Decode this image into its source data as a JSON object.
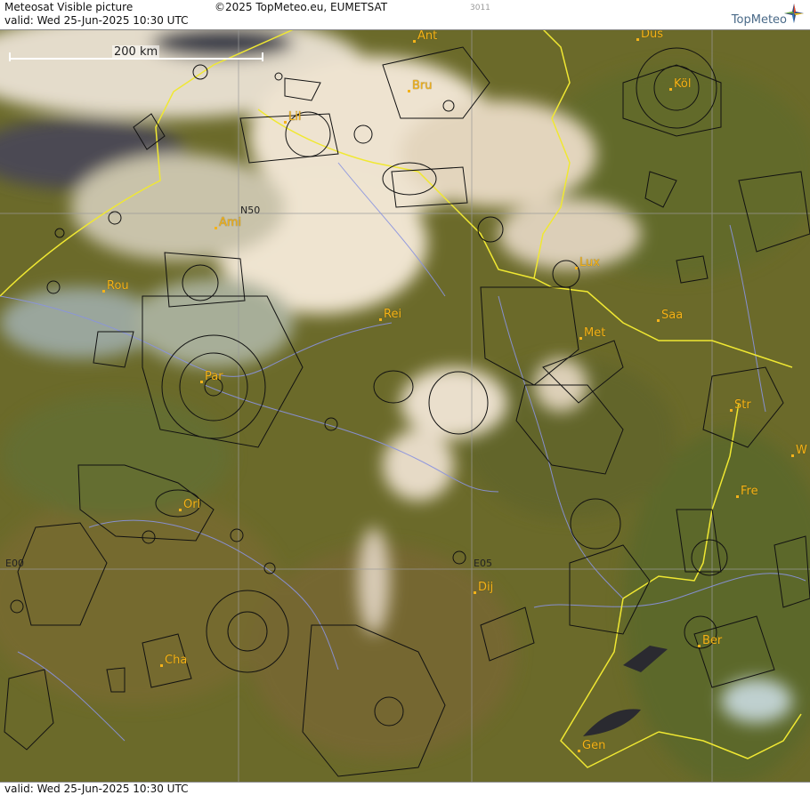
{
  "header": {
    "title": "Meteosat Visible picture",
    "copyright": "©2025 TopMeteo.eu, EUMETSAT",
    "valid": "valid:  Wed  25-Jun-2025  10:30 UTC",
    "code": "3011",
    "logo": "TopMeteo"
  },
  "footer": {
    "valid": "valid:  Wed  25-Jun-2025  10:30 UTC"
  },
  "scale": {
    "label": "200 km"
  },
  "grid_labels": {
    "n50": "N50",
    "e00": "E00",
    "e05": "E05"
  },
  "cities": [
    {
      "id": "ant",
      "label": "Ant"
    },
    {
      "id": "dus",
      "label": "Düs"
    },
    {
      "id": "bru",
      "label": "Bru"
    },
    {
      "id": "kol",
      "label": "Köl"
    },
    {
      "id": "lil",
      "label": "Lil"
    },
    {
      "id": "ami",
      "label": "Ami"
    },
    {
      "id": "rou",
      "label": "Rou"
    },
    {
      "id": "lux",
      "label": "Lux"
    },
    {
      "id": "rei",
      "label": "Rei"
    },
    {
      "id": "saa",
      "label": "Saa"
    },
    {
      "id": "met",
      "label": "Met"
    },
    {
      "id": "par",
      "label": "Par"
    },
    {
      "id": "str",
      "label": "Str"
    },
    {
      "id": "w",
      "label": "W"
    },
    {
      "id": "fre",
      "label": "Fre"
    },
    {
      "id": "orl",
      "label": "Orl"
    },
    {
      "id": "dij",
      "label": "Dij"
    },
    {
      "id": "ber",
      "label": "Ber"
    },
    {
      "id": "cha",
      "label": "Cha"
    },
    {
      "id": "gen",
      "label": "Gen"
    }
  ],
  "colors": {
    "land": "#6b6a2a",
    "cloud": "#eadfcc",
    "border": "#f0e832",
    "river": "#8a93e0",
    "airspace": "#111111",
    "city": "#f4b21a"
  }
}
